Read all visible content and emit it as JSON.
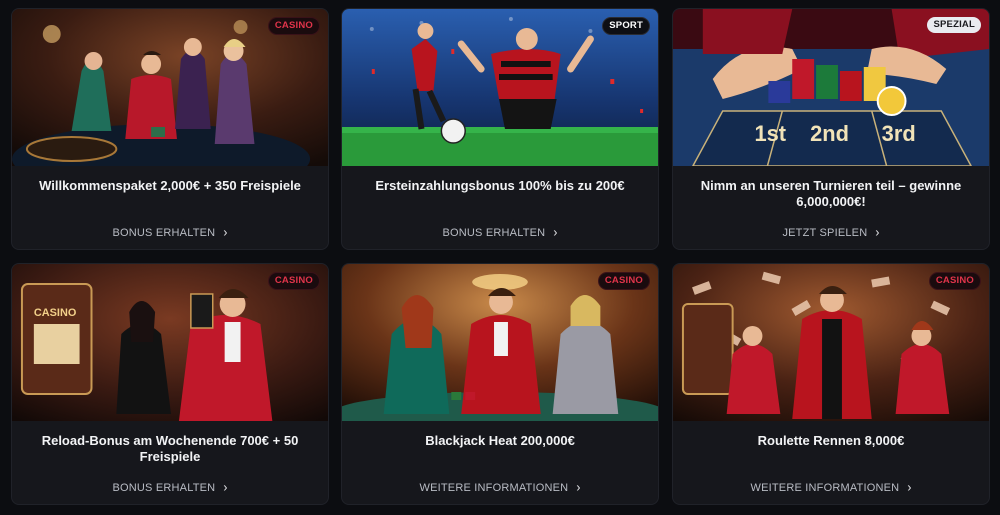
{
  "cards": [
    {
      "badge": "CASINO",
      "title": "Willkommenspaket 2,000€ + 350 Freispiele",
      "cta": "BONUS ERHALTEN",
      "image": "casino-roulette-group"
    },
    {
      "badge": "SPORT",
      "title": "Ersteinzahlungsbonus 100% bis zu 200€",
      "cta": "BONUS ERHALTEN",
      "image": "football-players-stadium"
    },
    {
      "badge": "SPEZIAL",
      "title": "Nimm an unseren Turnieren teil – gewinne 6,000,000€!",
      "cta": "JETZT SPIELEN",
      "image": "roulette-table-chips",
      "table_labels": [
        "1st",
        "2nd",
        "3rd"
      ]
    },
    {
      "badge": "CASINO",
      "title": "Reload-Bonus am Wochenende 700€ + 50 Freispiele",
      "cta": "BONUS ERHALTEN",
      "image": "casino-slot-couple",
      "sign_text": "CASINO"
    },
    {
      "badge": "CASINO",
      "title": "Blackjack Heat 200,000€",
      "cta": "WEITERE INFORMATIONEN",
      "image": "blackjack-table-trio"
    },
    {
      "badge": "CASINO",
      "title": "Roulette Rennen 8,000€",
      "cta": "WEITERE INFORMATIONEN",
      "image": "money-rain-casino"
    }
  ],
  "icons": {
    "cta_arrow": "chevron-right-icon",
    "cta_glyph": "›"
  },
  "colors": {
    "background": "#0c0d11",
    "card": "#16171c",
    "casino_badge": "#e0344a"
  }
}
